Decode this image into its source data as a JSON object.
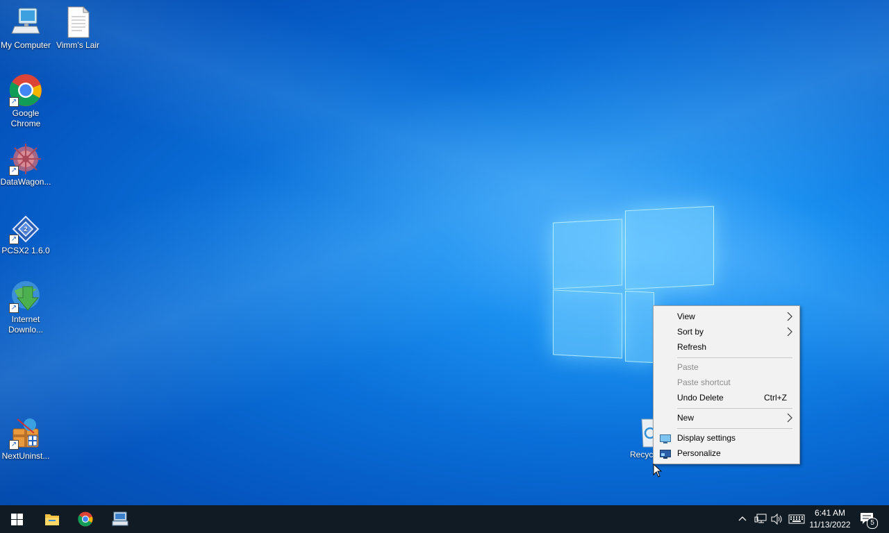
{
  "desktop": {
    "icons": [
      {
        "label": "My Computer"
      },
      {
        "label": "Vimm's Lair"
      },
      {
        "label": "Google Chrome"
      },
      {
        "label": "DataWagon..."
      },
      {
        "label": "PCSX2 1.6.0"
      },
      {
        "label": "Internet Downlo..."
      },
      {
        "label": "NextUninst..."
      },
      {
        "label": "Recycl"
      }
    ]
  },
  "context_menu": {
    "view": "View",
    "sort_by": "Sort by",
    "refresh": "Refresh",
    "paste": "Paste",
    "paste_shortcut": "Paste shortcut",
    "undo_delete": "Undo Delete",
    "undo_shortcut": "Ctrl+Z",
    "new": "New",
    "display_settings": "Display settings",
    "personalize": "Personalize"
  },
  "taskbar": {
    "time": "6:41 AM",
    "date": "11/13/2022",
    "notification_count": "5"
  },
  "colors": {
    "taskbar_bg": "#101b24",
    "menu_bg": "#f2f2f2",
    "desktop_accent": "#0a6fd8"
  }
}
